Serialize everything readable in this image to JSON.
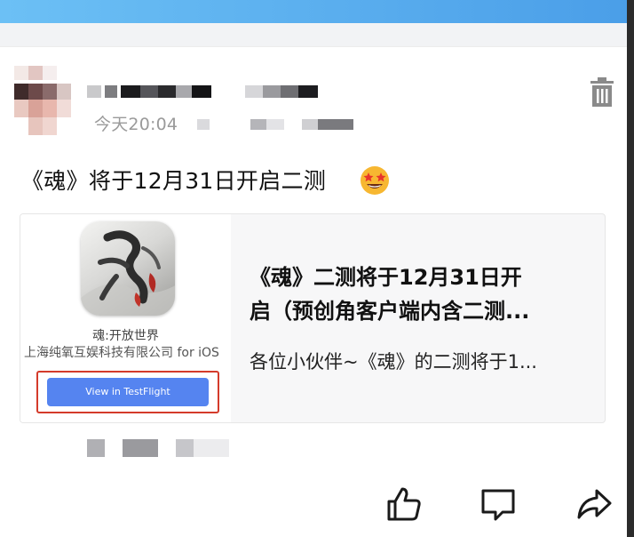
{
  "post": {
    "timestamp": "今天20:04",
    "text": "《魂》将于12月31日开启二测",
    "emoji": "star-struck-emoji"
  },
  "link_card": {
    "app_name": "魂:开放世界",
    "app_company": "上海纯氧互娱科技有限公司 for iOS",
    "testflight_button": "View in TestFlight",
    "title_line1": "《魂》二测将于12月31日开",
    "title_line2": "启（预创角客户端内含二测...",
    "description": "各位小伙伴~《魂》的二测将于1..."
  },
  "icons": {
    "delete": "trash-icon",
    "like": "thumbs-up-icon",
    "comment": "comment-icon",
    "share": "share-icon"
  },
  "colors": {
    "top_bar": "#4a9ee8",
    "testflight_button": "#5584f0",
    "highlight_frame": "#d43b2b",
    "timestamp": "#9a9a9a"
  }
}
